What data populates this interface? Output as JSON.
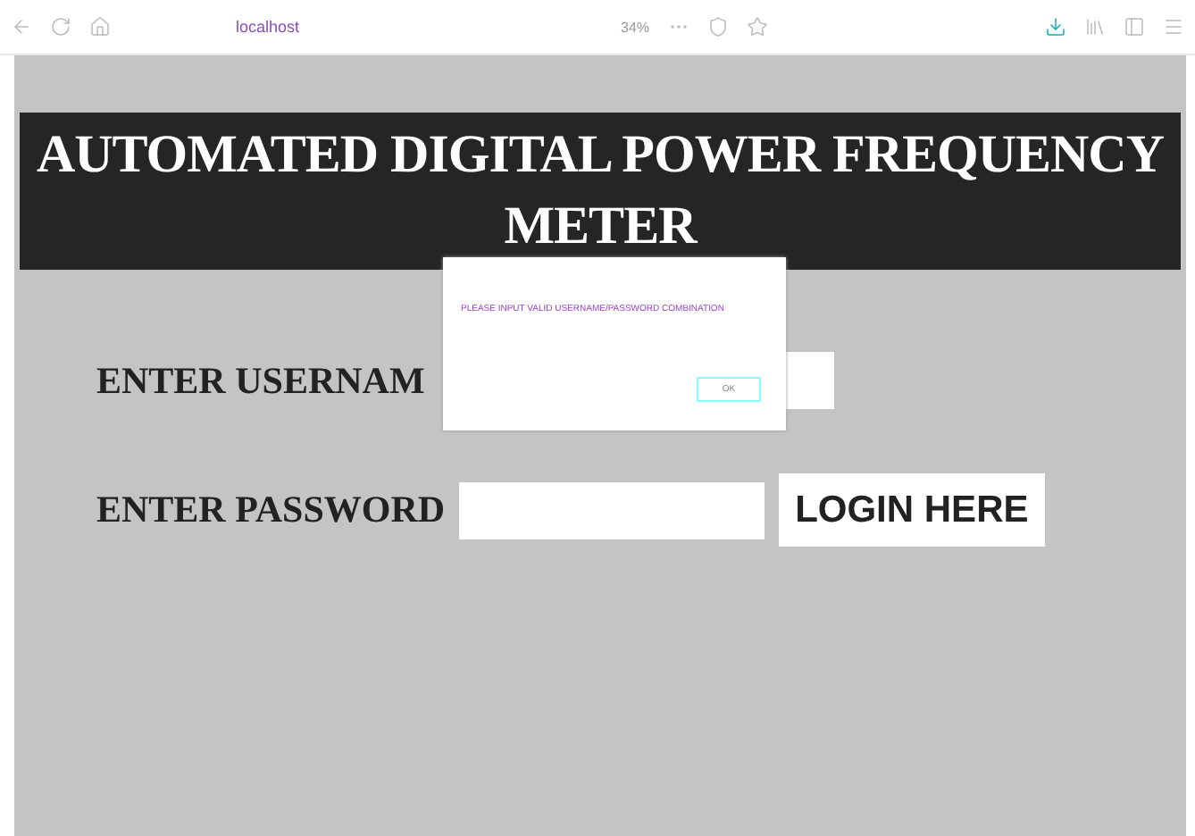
{
  "browser": {
    "url": "localhost",
    "zoom": "34%"
  },
  "header": {
    "title": "AUTOMATED DIGITAL POWER FREQUENCY METER"
  },
  "form": {
    "username_label": "ENTER USERNAM",
    "password_label": "ENTER PASSWORD",
    "login_button": "LOGIN HERE"
  },
  "dialog": {
    "message": "PLEASE INPUT VALID USERNAME/PASSWORD COMBINATION",
    "ok_button": "OK"
  }
}
